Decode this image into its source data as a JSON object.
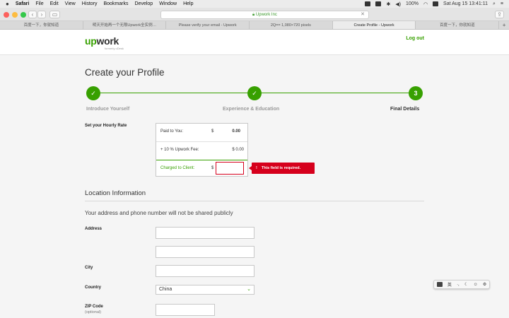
{
  "menubar": {
    "apple": "",
    "items": [
      "Safari",
      "File",
      "Edit",
      "View",
      "History",
      "Bookmarks",
      "Develop",
      "Window",
      "Help"
    ],
    "battery": "100%",
    "clock": "Sat Aug 15  13:41:11"
  },
  "browser": {
    "url": "Upwork Inc",
    "tabs": [
      "百度一下，你就知道",
      "明天开始再一个无限Upwork全实例…",
      "Please verify your email - Upwork",
      "2Q== 1,080×720 pixels",
      "Create Profile - Upwork",
      "百度一下，你就知道"
    ],
    "active_tab_index": 4
  },
  "header": {
    "logo_prefix": "up",
    "logo_suffix": "work",
    "logo_sub": "formerly oDesk",
    "logout_label": "Log out"
  },
  "page": {
    "title": "Create your Profile",
    "steps": [
      {
        "label": "Introduce Yourself",
        "marker": "✓",
        "state": "done"
      },
      {
        "label": "Experience & Education",
        "marker": "✓",
        "state": "done"
      },
      {
        "label": "Final Details",
        "marker": "3",
        "state": "current"
      }
    ]
  },
  "rate": {
    "section_label": "Set your Hourly Rate",
    "paid_label": "Paid to You:",
    "paid_currency": "$",
    "paid_value": "0.00",
    "fee_label": "+ 10 % Upwork Fee:",
    "fee_value": "$ 0.00",
    "client_label": "Charged to Client:",
    "client_currency": "$",
    "client_value": "",
    "error_text": "This field is required."
  },
  "location": {
    "title": "Location Information",
    "privacy_note": "Your address and phone number will not be shared publicly",
    "address_label": "Address",
    "address1_value": "",
    "address2_value": "",
    "city_label": "City",
    "city_value": "",
    "country_label": "Country",
    "country_value": "China",
    "zip_label": "ZIP Code",
    "zip_optional": "(optional)",
    "zip_value": ""
  },
  "ime": {
    "lang": "英"
  },
  "colors": {
    "brand_green": "#37a000",
    "error_red": "#d6001c"
  }
}
